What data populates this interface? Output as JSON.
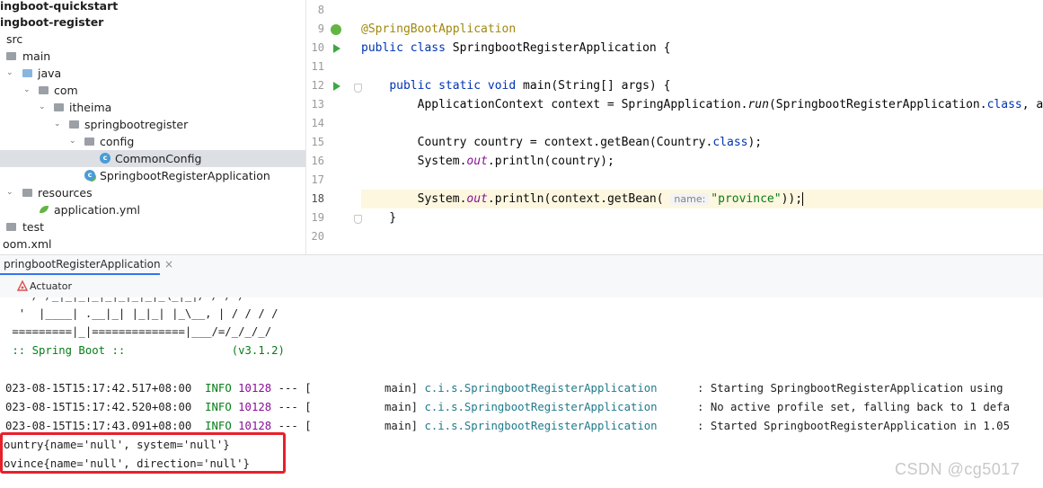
{
  "project_tree": {
    "items": [
      {
        "label": "ingboot-quickstart",
        "bold": true
      },
      {
        "label": "ingboot-register",
        "bold": true
      },
      {
        "label": "src"
      },
      {
        "label": "main"
      },
      {
        "label": "java"
      },
      {
        "label": "com"
      },
      {
        "label": "itheima"
      },
      {
        "label": "springbootregister"
      },
      {
        "label": "config"
      },
      {
        "label": "CommonConfig",
        "selected": true
      },
      {
        "label": "SpringbootRegisterApplication"
      },
      {
        "label": "resources"
      },
      {
        "label": "application.yml"
      },
      {
        "label": "test"
      },
      {
        "label": "oom.xml"
      }
    ],
    "class_badge": "c"
  },
  "editor": {
    "current_line": "18",
    "lines": [
      {
        "num": "8",
        "code": ""
      },
      {
        "num": "9",
        "code": "@SpringBootApplication"
      },
      {
        "num": "10",
        "code": "public class SpringbootRegisterApplication {"
      },
      {
        "num": "11",
        "code": ""
      },
      {
        "num": "12",
        "code": "    public static void main(String[] args) {"
      },
      {
        "num": "13",
        "code": "        ApplicationContext context = SpringApplication.run(SpringbootRegisterApplication.class, arg"
      },
      {
        "num": "14",
        "code": ""
      },
      {
        "num": "15",
        "code": "        Country country = context.getBean(Country.class);"
      },
      {
        "num": "16",
        "code": "        System.out.println(country);"
      },
      {
        "num": "17",
        "code": ""
      },
      {
        "num": "18",
        "code": "        System.out.println(context.getBean( name: \"province\"));"
      },
      {
        "num": "19",
        "code": "    }"
      },
      {
        "num": "20",
        "code": ""
      }
    ],
    "parts": {
      "annotation": "@SpringBootApplication",
      "kw_public": "public",
      "kw_class": "class",
      "kw_static": "static",
      "kw_void": "void",
      "class_decl_name": " SpringbootRegisterApplication {",
      "main_sig": " main(String[] args) {",
      "l13_a": "        ApplicationContext context = SpringApplication.",
      "l13_run": "run",
      "l13_b": "(SpringbootRegisterApplication.",
      "l13_class": "class",
      "l13_c": ", arg",
      "l15_a": "        Country country = context.getBean(Country.",
      "l15_class": "class",
      "l15_b": ");",
      "l16_a": "        System.",
      "l16_out": "out",
      "l16_b": ".println(country);",
      "l18_a": "        System.",
      "l18_out": "out",
      "l18_b": ".println(context.getBean( ",
      "l18_hint": "name:",
      "l18_str": "\"province\"",
      "l18_c": "));",
      "l19": "    }"
    }
  },
  "run_window": {
    "tab_label": "pringbootRegisterApplication",
    "tab_close": "×",
    "actuator_label": "Actuator",
    "console": {
      "banner": [
        "  '  |____| .__|_| |_|_| |_\\__, | / / / /",
        " =========|_|==============|___/=/_/_/_/",
        " :: Spring Boot ::                (v3.1.2)"
      ],
      "logs": [
        {
          "ts": "023-08-15T15:17:42.517+08:00",
          "level": "INFO",
          "pid": "10128",
          "sep": " --- [",
          "thread": "           main]",
          "logger": "c.i.s.SpringbootRegisterApplication",
          "msg": "      : Starting SpringbootRegisterApplication using"
        },
        {
          "ts": "023-08-15T15:17:42.520+08:00",
          "level": "INFO",
          "pid": "10128",
          "sep": " --- [",
          "thread": "           main]",
          "logger": "c.i.s.SpringbootRegisterApplication",
          "msg": "      : No active profile set, falling back to 1 defa"
        },
        {
          "ts": "023-08-15T15:17:43.091+08:00",
          "level": "INFO",
          "pid": "10128",
          "sep": " --- [",
          "thread": "           main]",
          "logger": "c.i.s.SpringbootRegisterApplication",
          "msg": "      : Started SpringbootRegisterApplication in 1.05"
        }
      ],
      "output": [
        "ountry{name='null', system='null'}",
        "ovince{name='null', direction='null'}"
      ]
    }
  },
  "watermark": "CSDN @cg5017",
  "colors": {
    "highlight_box": "#e8202a",
    "selection": "#dcdfe4",
    "current_line": "#fdf7e0"
  }
}
